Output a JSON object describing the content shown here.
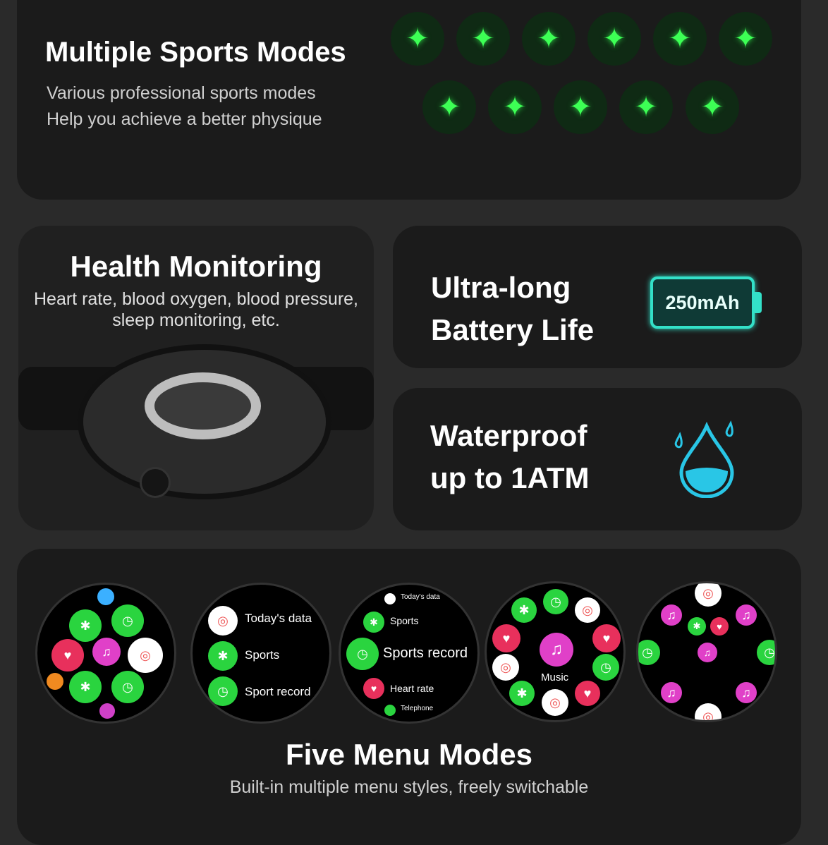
{
  "sports": {
    "title": "Multiple Sports Modes",
    "line1": "Various professional sports modes",
    "line2": "Help you achieve a better physique",
    "icons": [
      "weightlifting-icon",
      "baseball-icon",
      "hula-hoop-icon",
      "stair-climber-icon",
      "barbell-icon",
      "hiking-icon",
      "dance-icon",
      "stretching-icon",
      "martial-arts-icon",
      "rowing-icon",
      "cycling-icon"
    ],
    "accent": "#3dff55"
  },
  "health": {
    "title": "Health Monitoring",
    "line1": "Heart rate, blood oxygen, blood pressure,",
    "line2": "sleep monitoring, etc."
  },
  "battery": {
    "line1": "Ultra-long",
    "line2": "Battery Life",
    "capacity": "250mAh",
    "accent": "#33e0c8"
  },
  "water": {
    "line1": "Waterproof",
    "line2": "up to 1ATM",
    "accent": "#29c6e6"
  },
  "menus": {
    "title": "Five Menu Modes",
    "subtitle": "Built-in multiple menu styles, freely switchable",
    "list_face": [
      "Today's data",
      "Sports",
      "Sport record"
    ],
    "scroll_face": [
      "Today's data",
      "Sports",
      "Sports record",
      "Heart rate",
      "Telephone"
    ],
    "music_label": "Music"
  }
}
